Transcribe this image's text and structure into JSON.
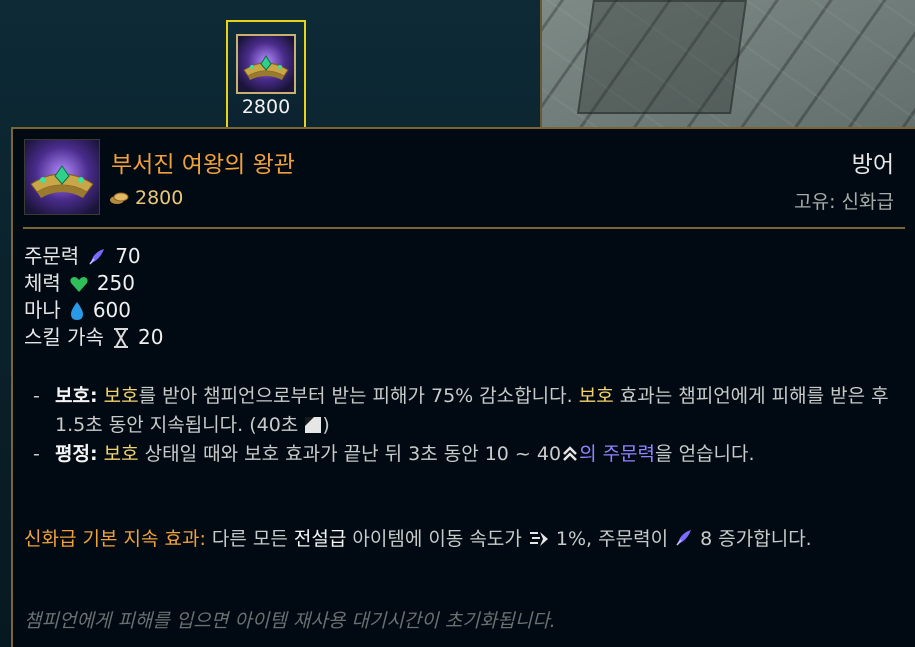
{
  "shop": {
    "selected_item_price": "2800"
  },
  "tooltip": {
    "item_name": "부서진 여왕의 왕관",
    "cost": "2800",
    "category": "방어",
    "rarity": "고유: 신화급",
    "stats": [
      {
        "label": "주문력",
        "icon": "ability-power-icon",
        "value": "70"
      },
      {
        "label": "체력",
        "icon": "health-heart-icon",
        "value": "250"
      },
      {
        "label": "마나",
        "icon": "mana-drop-icon",
        "value": "600"
      },
      {
        "label": "스킬 가속",
        "icon": "ability-haste-hourglass-icon",
        "value": "20"
      }
    ],
    "passives": {
      "guard": {
        "dash": "-",
        "name": "보호:",
        "kw1": "보호",
        "text1": "를 받아 챔피언으로부터 받는 피해가 75% 감소합니다.",
        "kw2": "보호",
        "text2": "효과는 챔피언에게 피해를 받은 후 1.5초 동안 지속됩니다. (40초",
        "text3": ")"
      },
      "poise": {
        "dash": "-",
        "name": "평정:",
        "kw1": "보호",
        "text1": "상태일 때와 보호 효과가 끝난 뒤 3초 동안 10 ~ 40",
        "kw2": "의 주문력",
        "text2": "을 얻습니다."
      }
    },
    "mythic": {
      "label": "신화급 기본 지속 효과:",
      "text1": "다른 모든",
      "kw": "전설급",
      "text2": "아이템에 이동 속도가",
      "text3": "1%, 주문력이",
      "text4": "8 증가합니다."
    },
    "flavor": "챔피언에게 피해를 입으면 아이템 재사용 대기시간이 초기화됩니다.",
    "colors": {
      "item_name": "#f0a13a",
      "border_gold": "#7a6535",
      "keyword_yellow": "#f4d36a",
      "keyword_blue": "#8e86ff",
      "mythic_orange": "#f0a13a",
      "slot_highlight": "#e8d21c"
    }
  }
}
